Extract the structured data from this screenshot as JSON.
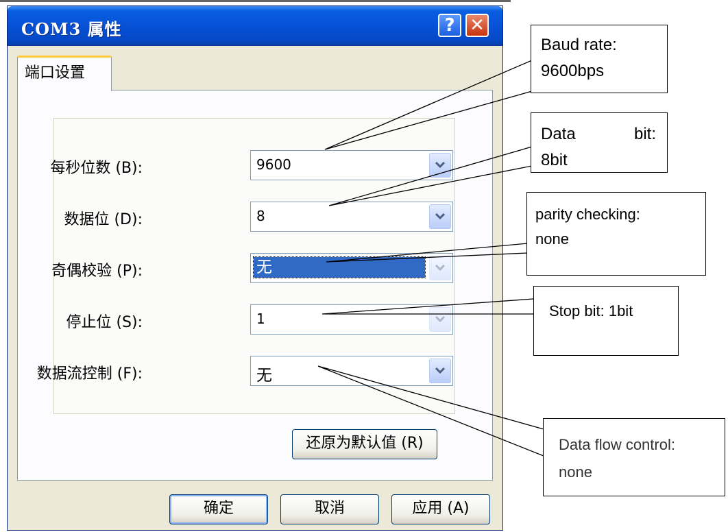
{
  "dialog": {
    "title": "COM3 属性",
    "help_glyph": "?",
    "close_glyph": "✕",
    "tab_label": "端口设置",
    "fields": [
      {
        "label": "每秒位数 (B):",
        "value": "9600"
      },
      {
        "label": "数据位 (D):",
        "value": "8"
      },
      {
        "label": "奇偶校验 (P):",
        "value": "无"
      },
      {
        "label": "停止位 (S):",
        "value": "1"
      },
      {
        "label": "数据流控制 (F):",
        "value": "无"
      }
    ],
    "restore_defaults_label": "还原为默认值 (R)",
    "ok_label": "确定",
    "cancel_label": "取消",
    "apply_label": "应用 (A)"
  },
  "annotations": {
    "baud_rate": {
      "line1": "Baud rate:",
      "line2": "9600bps"
    },
    "data_bit": {
      "line1a": "Data",
      "line1b": "bit:",
      "line2": "8bit"
    },
    "parity": {
      "line1": "parity checking:",
      "line2": "none"
    },
    "stop_bit": {
      "line1": "Stop bit: 1bit"
    },
    "flow_control": {
      "line1": "Data flow control:",
      "line2": "none"
    }
  },
  "colors": {
    "titlebar": "#0751d6",
    "dialog_face": "#ece9d8",
    "selection": "#316ac5",
    "close_button": "#c9330f",
    "tab_accent": "#ffc83c"
  }
}
